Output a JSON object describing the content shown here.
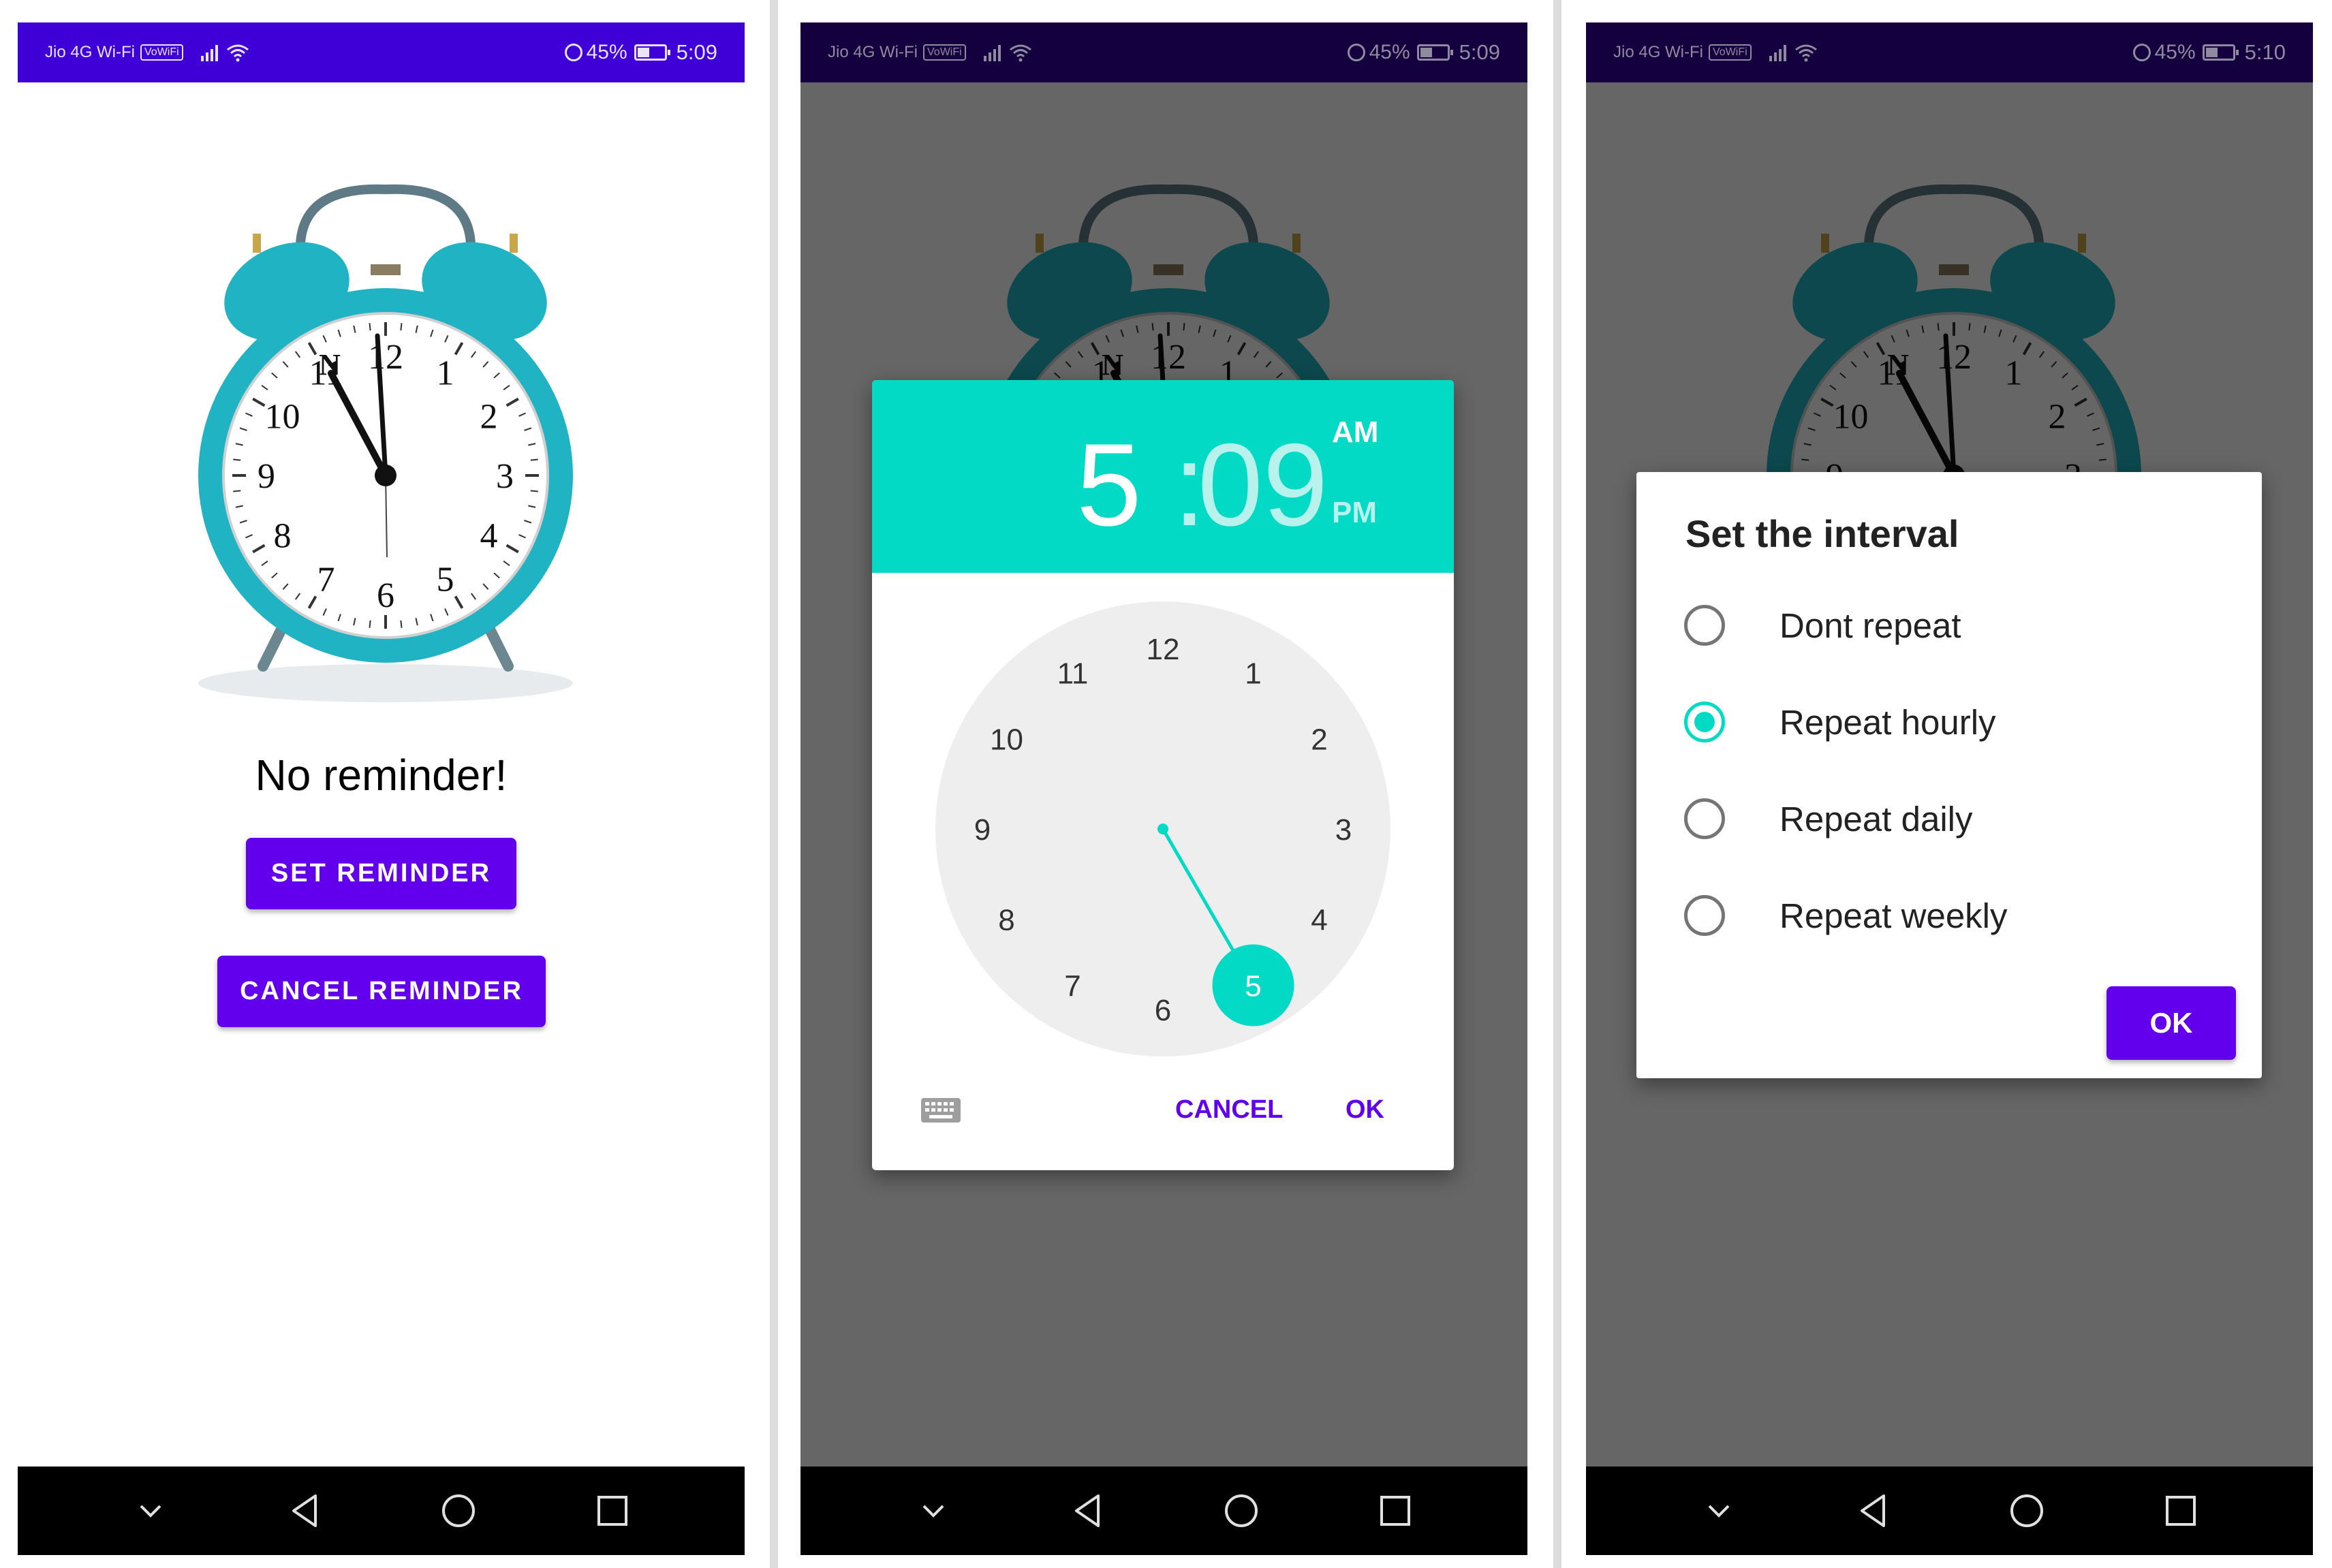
{
  "status_bar": {
    "carrier": "Jio 4G Wi-Fi",
    "wifi_badge": "VoWiFi",
    "battery": "45%",
    "battery_level": 0.45,
    "times": [
      "5:09",
      "5:09",
      "5:10"
    ]
  },
  "colors": {
    "primary": "#6200ee",
    "status_bar": "#3f00d8",
    "accent": "#03dac5",
    "clock_body": "#1fb3c4"
  },
  "screen1": {
    "message": "No reminder!",
    "set_button": "SET REMINDER",
    "cancel_button": "CANCEL REMINDER"
  },
  "screen2": {
    "hour": "5",
    "separator": ":",
    "minute": "09",
    "am": "AM",
    "pm": "PM",
    "selected_hour": "5",
    "dial": [
      "12",
      "1",
      "2",
      "3",
      "4",
      "5",
      "6",
      "7",
      "8",
      "9",
      "10",
      "11"
    ],
    "cancel": "CANCEL",
    "ok": "OK"
  },
  "screen3": {
    "title": "Set the interval",
    "options": [
      {
        "label": "Dont repeat",
        "selected": false
      },
      {
        "label": "Repeat hourly",
        "selected": true
      },
      {
        "label": "Repeat daily",
        "selected": false
      },
      {
        "label": "Repeat weekly",
        "selected": false
      }
    ],
    "ok": "OK"
  },
  "alarm_clock": {
    "numerals": [
      "12",
      "1",
      "2",
      "3",
      "4",
      "5",
      "6",
      "7",
      "8",
      "9",
      "10",
      "11"
    ],
    "brand": "N"
  },
  "nav_icons": [
    "chevron-down-icon",
    "back-triangle-icon",
    "home-circle-icon",
    "recents-square-icon"
  ]
}
